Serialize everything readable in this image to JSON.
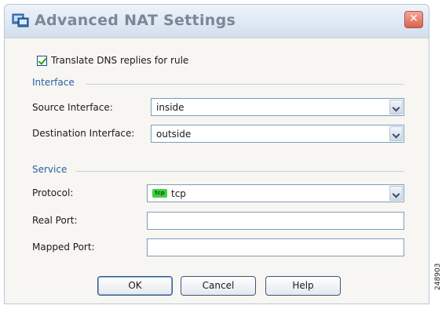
{
  "window": {
    "title": "Advanced NAT Settings"
  },
  "translate_dns": {
    "label": "Translate DNS replies for rule",
    "checked": true
  },
  "interface": {
    "section_title": "Interface",
    "source_label": "Source Interface:",
    "source_value": "inside",
    "destination_label": "Destination Interface:",
    "destination_value": "outside"
  },
  "service": {
    "section_title": "Service",
    "protocol_label": "Protocol:",
    "protocol_badge": "tcp",
    "protocol_value": "tcp",
    "real_port_label": "Real Port:",
    "real_port_value": "",
    "mapped_port_label": "Mapped Port:",
    "mapped_port_value": ""
  },
  "buttons": {
    "ok": "OK",
    "cancel": "Cancel",
    "help": "Help"
  },
  "side_label": "248903",
  "icons": {
    "app": "network-app-icon",
    "close": "close-icon",
    "dropdown": "chevron-down-icon"
  },
  "colors": {
    "section_title": "#2c5fa8",
    "close_button": "#d9614f",
    "tcp_badge": "#3fcf3f"
  }
}
